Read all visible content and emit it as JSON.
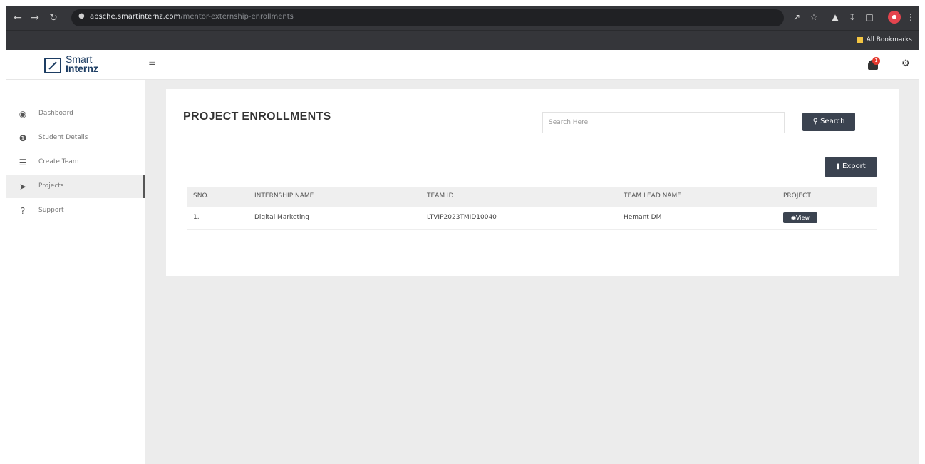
{
  "browser": {
    "url_host": "apsche.smartinternz.com",
    "url_path": "/mentor-externship-enrollments",
    "bookmarks_label": "All Bookmarks"
  },
  "app": {
    "logo_line1": "Smart",
    "logo_line2": "Internz",
    "notification_count": "1"
  },
  "sidebar": {
    "items": [
      {
        "label": "Dashboard",
        "icon": "dashboard-icon"
      },
      {
        "label": "Student Details",
        "icon": "info-icon"
      },
      {
        "label": "Create Team",
        "icon": "list-icon"
      },
      {
        "label": "Projects",
        "icon": "send-icon"
      },
      {
        "label": "Support",
        "icon": "question-icon"
      }
    ]
  },
  "main": {
    "title": "PROJECT ENROLLMENTS",
    "search_placeholder": "Search Here",
    "search_label": "Search",
    "export_label": "Export",
    "table": {
      "headers": [
        "SNO.",
        "INTERNSHIP NAME",
        "TEAM ID",
        "TEAM LEAD NAME",
        "PROJECT"
      ],
      "rows": [
        {
          "sno": "1.",
          "internship": "Digital Marketing",
          "team_id": "LTVIP2023TMID10040",
          "lead": "Hemant DM",
          "action": "View"
        }
      ]
    }
  },
  "colors": {
    "primary_button": "#3b4350",
    "badge": "#e5392e",
    "brand": "#1d3d63"
  }
}
